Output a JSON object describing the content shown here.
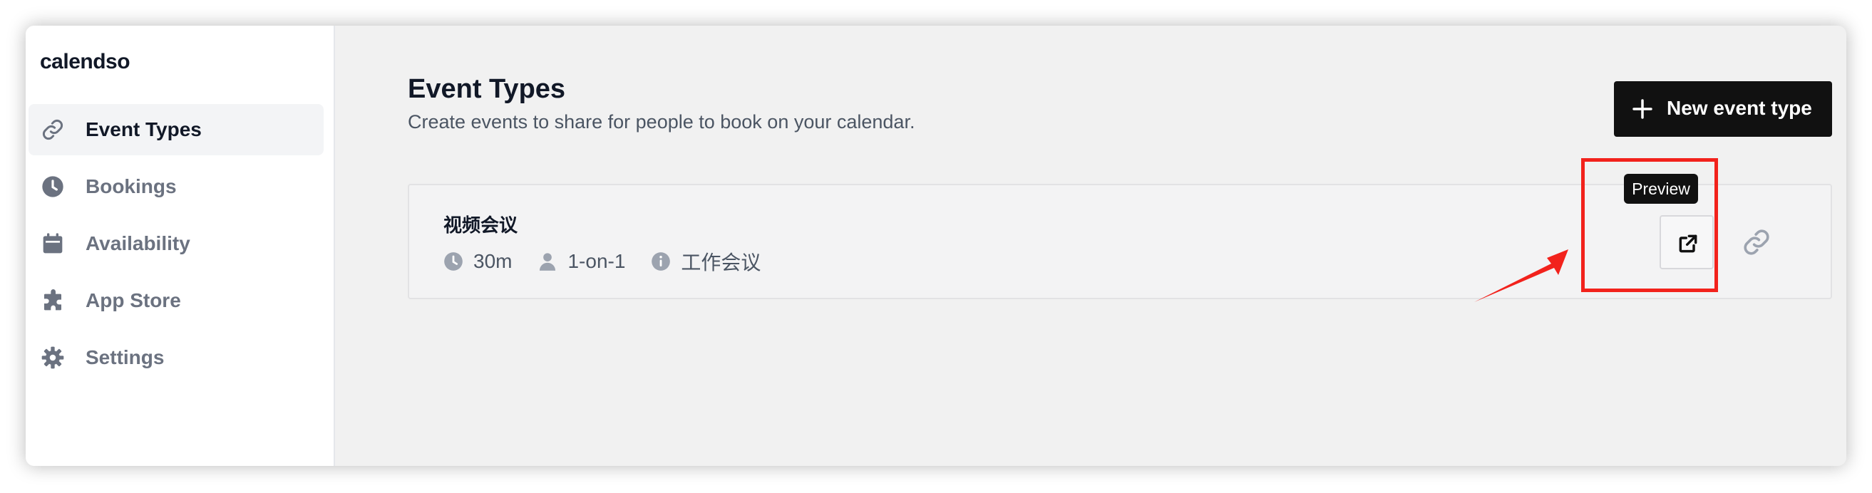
{
  "app": {
    "logo_text": "calendso"
  },
  "sidebar": {
    "items": [
      {
        "label": "Event Types",
        "icon": "link-icon",
        "active": true
      },
      {
        "label": "Bookings",
        "icon": "clock-icon",
        "active": false
      },
      {
        "label": "Availability",
        "icon": "calendar-icon",
        "active": false
      },
      {
        "label": "App Store",
        "icon": "puzzle-icon",
        "active": false
      },
      {
        "label": "Settings",
        "icon": "gear-icon",
        "active": false
      }
    ]
  },
  "header": {
    "title": "Event Types",
    "subtitle": "Create events to share for people to book on your calendar.",
    "new_button_label": "New event type",
    "new_button_icon": "plus-icon"
  },
  "event_types": [
    {
      "title": "视频会议",
      "duration": "30m",
      "duration_icon": "clock-icon",
      "type": "1-on-1",
      "type_icon": "user-icon",
      "description": "工作会议",
      "description_icon": "info-icon",
      "actions": [
        {
          "name": "preview",
          "icon": "external-link-icon",
          "tooltip": "Preview"
        },
        {
          "name": "copy-link",
          "icon": "link-icon"
        }
      ]
    }
  ],
  "annotation": {
    "highlight_color": "#f2221c",
    "arrow_color": "#f2221c"
  },
  "colors": {
    "primary_button": "#111111",
    "active_nav_bg": "#f3f4f6",
    "muted_text": "#6b7280"
  }
}
